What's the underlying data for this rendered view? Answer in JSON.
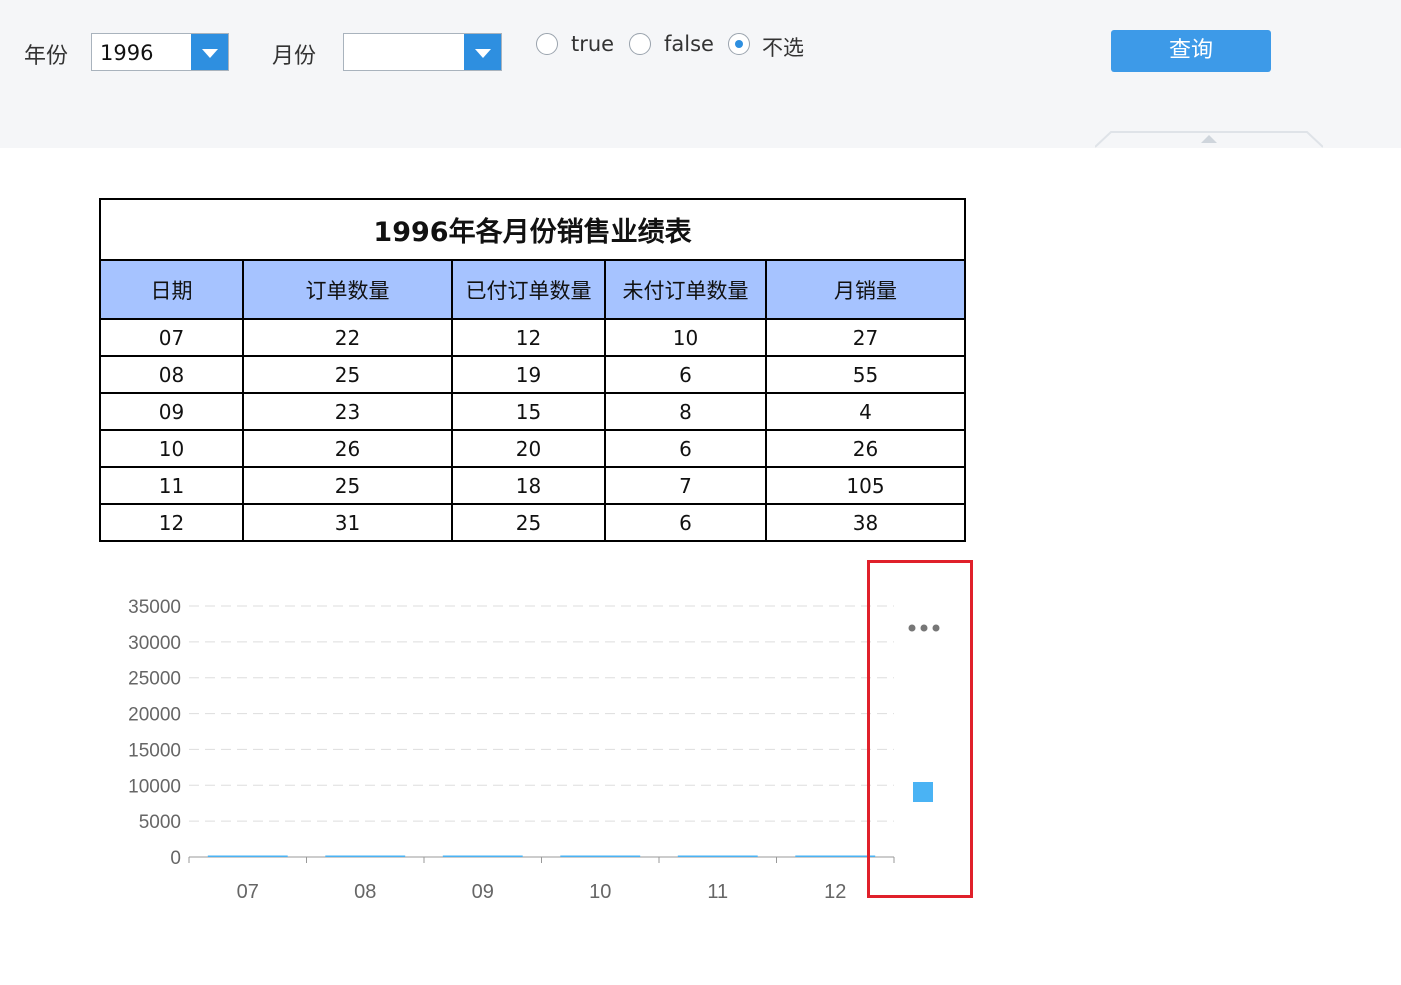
{
  "toolbar": {
    "year_label": "年份",
    "year_value": "1996",
    "month_label": "月份",
    "month_value": "",
    "radio_true": "true",
    "radio_false": "false",
    "radio_none": "不选",
    "selected_radio": "不选",
    "query_button": "查询"
  },
  "report": {
    "title": "1996年各月份销售业绩表",
    "columns": [
      "日期",
      "订单数量",
      "已付订单数量",
      "未付订单数量",
      "月销量"
    ],
    "rows": [
      [
        "07",
        "22",
        "12",
        "10",
        "27"
      ],
      [
        "08",
        "25",
        "19",
        "6",
        "55"
      ],
      [
        "09",
        "23",
        "15",
        "8",
        "4"
      ],
      [
        "10",
        "26",
        "20",
        "6",
        "26"
      ],
      [
        "11",
        "25",
        "18",
        "7",
        "105"
      ],
      [
        "12",
        "31",
        "25",
        "6",
        "38"
      ]
    ]
  },
  "chart_data": {
    "type": "bar",
    "categories": [
      "07",
      "08",
      "09",
      "10",
      "11",
      "12"
    ],
    "series": [
      {
        "values": [
          27,
          55,
          4,
          26,
          105,
          38
        ]
      }
    ],
    "ylim": [
      0,
      35000
    ],
    "yticks": [
      "35000",
      "30000",
      "25000",
      "20000",
      "15000",
      "10000",
      "5000",
      "0"
    ],
    "grid": true,
    "colors": {
      "bar": "#4ab3f4",
      "grid": "#dddddd",
      "axis": "#999999"
    },
    "legend": "right"
  },
  "icons": {
    "dropdown": "chevron-down-icon",
    "more": "more-dots-icon",
    "collapse": "collapse-arrow-icon"
  },
  "colors": {
    "accent": "#2e8fe0",
    "table_header": "#a6c3ff",
    "highlight": "#e0202a"
  }
}
